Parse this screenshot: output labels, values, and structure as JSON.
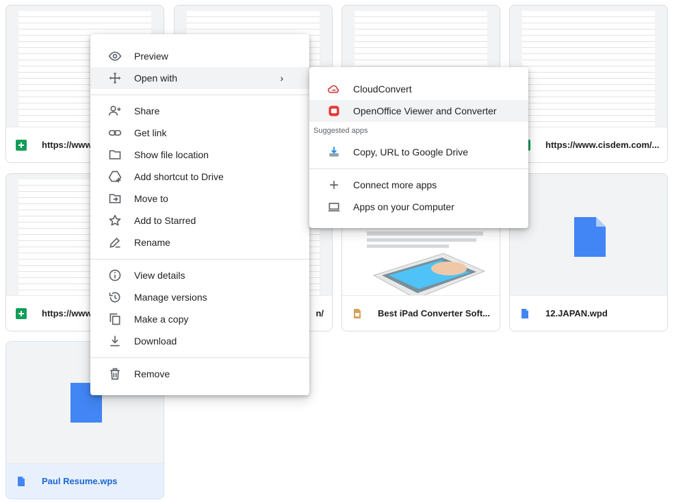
{
  "files": [
    {
      "name": "https://www",
      "type": "sheets"
    },
    {
      "name": "",
      "type": "sheets"
    },
    {
      "name": "",
      "type": "sheets"
    },
    {
      "name": "https://www.cisdem.com/...",
      "type": "sheets"
    },
    {
      "name": "https://www",
      "type": "sheets"
    },
    {
      "name": "n/",
      "type": "sheets"
    },
    {
      "name": "Best iPad Converter Soft...",
      "type": "slides"
    },
    {
      "name": "12.JAPAN.wpd",
      "type": "doc"
    },
    {
      "name": "Paul Resume.wps",
      "type": "doc"
    }
  ],
  "context_menu": {
    "items": [
      {
        "label": "Preview",
        "icon": "eye-icon"
      },
      {
        "label": "Open with",
        "icon": "move-arrows-icon"
      },
      {
        "label": "Share",
        "icon": "person-add-icon"
      },
      {
        "label": "Get link",
        "icon": "link-icon"
      },
      {
        "label": "Show file location",
        "icon": "folder-icon"
      },
      {
        "label": "Add shortcut to Drive",
        "icon": "drive-shortcut-icon"
      },
      {
        "label": "Move to",
        "icon": "move-to-folder-icon"
      },
      {
        "label": "Add to Starred",
        "icon": "star-icon"
      },
      {
        "label": "Rename",
        "icon": "pencil-icon"
      },
      {
        "label": "View details",
        "icon": "info-icon"
      },
      {
        "label": "Manage versions",
        "icon": "history-icon"
      },
      {
        "label": "Make a copy",
        "icon": "copy-icon"
      },
      {
        "label": "Download",
        "icon": "download-icon"
      },
      {
        "label": "Remove",
        "icon": "trash-icon"
      }
    ]
  },
  "open_with_menu": {
    "apps": [
      {
        "label": "CloudConvert",
        "icon": "cloudconvert-icon"
      },
      {
        "label": "OpenOffice Viewer and Converter",
        "icon": "openoffice-icon"
      }
    ],
    "suggested_heading": "Suggested apps",
    "suggested": [
      {
        "label": "Copy, URL to Google Drive",
        "icon": "copy-url-drive-icon"
      }
    ],
    "more": [
      {
        "label": "Connect more apps",
        "icon": "plus-icon"
      },
      {
        "label": "Apps on your Computer",
        "icon": "laptop-icon"
      }
    ]
  },
  "colors": {
    "accent": "#1a73e8",
    "sheets_green": "#0f9d58",
    "doc_blue": "#4285f4",
    "slides_orange": "#d4a35d",
    "selected_bg": "#e8f0fe"
  }
}
